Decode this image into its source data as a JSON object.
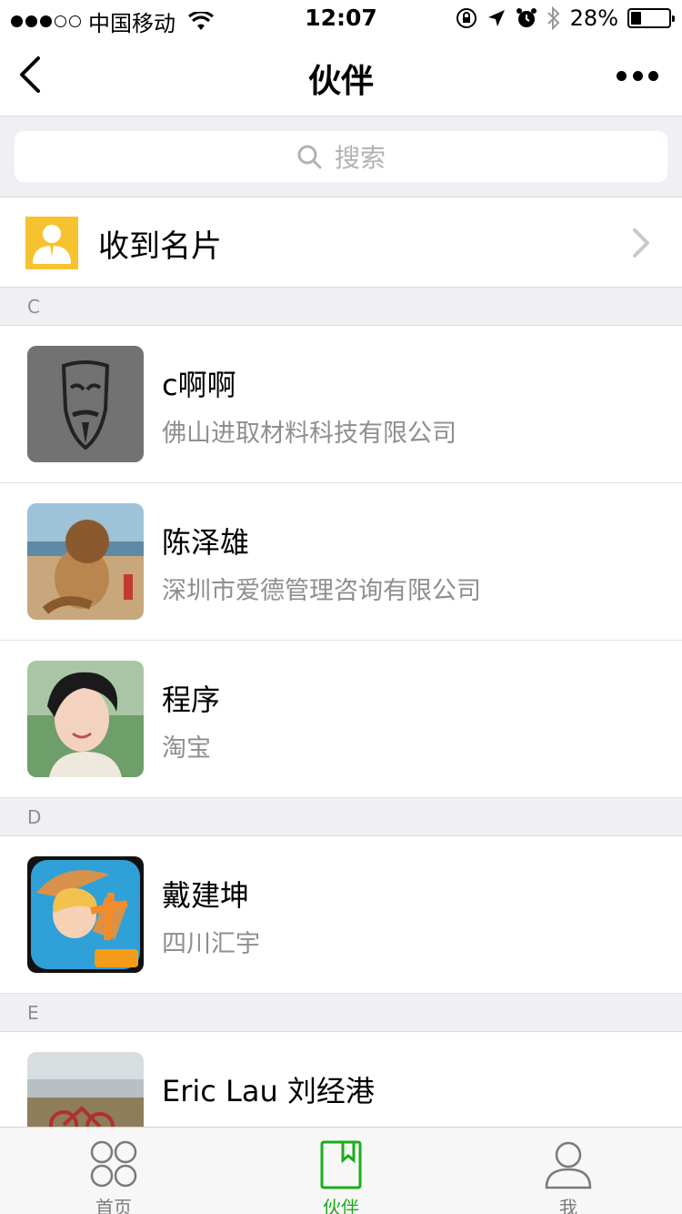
{
  "status_bar": {
    "carrier": "中国移动",
    "time": "12:07",
    "battery_percent_text": "28%",
    "battery_level": 0.28
  },
  "nav": {
    "title": "伙伴"
  },
  "search": {
    "placeholder": "搜索"
  },
  "received_card": {
    "label": "收到名片"
  },
  "sections": [
    {
      "letter": "C",
      "contacts": [
        {
          "name": "c啊啊",
          "company": "佛山进取材料科技有限公司"
        },
        {
          "name": "陈泽雄",
          "company": "深圳市爱德管理咨询有限公司"
        },
        {
          "name": "程序",
          "company": "淘宝"
        }
      ]
    },
    {
      "letter": "D",
      "contacts": [
        {
          "name": "戴建坤",
          "company": "四川汇宇"
        }
      ]
    },
    {
      "letter": "E",
      "contacts": [
        {
          "name": "Eric Lau 刘经港",
          "company": ""
        }
      ]
    }
  ],
  "tabs": [
    {
      "label": "首页",
      "icon": "grid-circles-icon"
    },
    {
      "label": "伙伴",
      "icon": "contact-book-icon",
      "active": true
    },
    {
      "label": "我",
      "icon": "person-icon"
    }
  ],
  "colors": {
    "accent_green": "#1aad19",
    "card_icon_yellow": "#f7c230"
  }
}
